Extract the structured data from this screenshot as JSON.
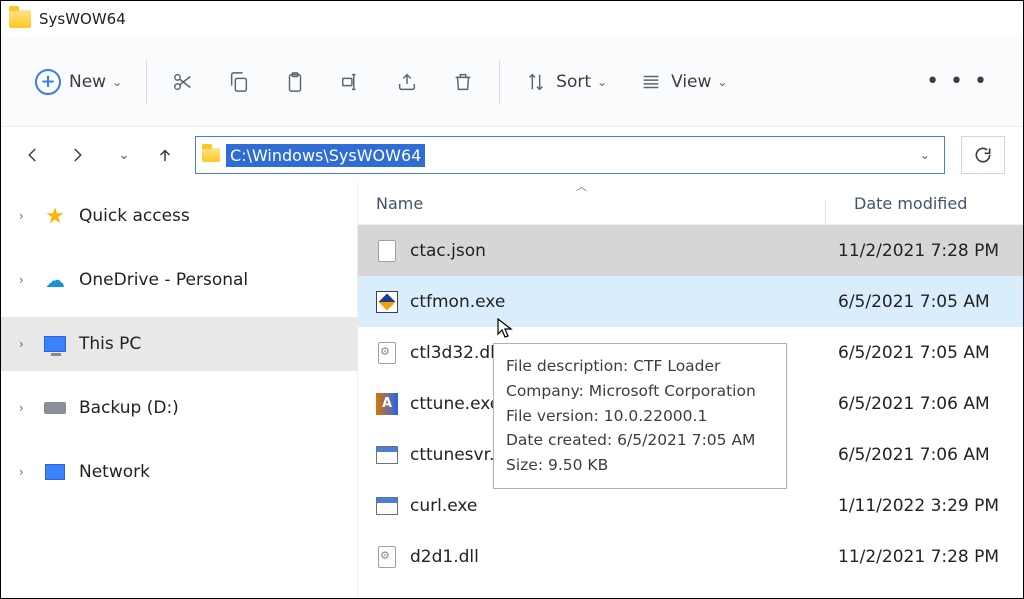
{
  "window": {
    "title": "SysWOW64"
  },
  "toolbar": {
    "new": "New",
    "sort": "Sort",
    "view": "View"
  },
  "address": {
    "path": "C:\\Windows\\SysWOW64"
  },
  "sidebar": {
    "items": [
      {
        "label": "Quick access"
      },
      {
        "label": "OneDrive - Personal"
      },
      {
        "label": "This PC"
      },
      {
        "label": "Backup (D:)"
      },
      {
        "label": "Network"
      }
    ]
  },
  "columns": {
    "name": "Name",
    "date": "Date modified"
  },
  "files": [
    {
      "name": "ctac.json",
      "date": "11/2/2021 7:28 PM"
    },
    {
      "name": "ctfmon.exe",
      "date": "6/5/2021 7:05 AM"
    },
    {
      "name": "ctl3d32.dll",
      "date": "6/5/2021 7:05 AM"
    },
    {
      "name": "cttune.exe",
      "date": "6/5/2021 7:06 AM"
    },
    {
      "name": "cttunesvr.exe",
      "date": "6/5/2021 7:06 AM"
    },
    {
      "name": "curl.exe",
      "date": "1/11/2022 3:29 PM"
    },
    {
      "name": "d2d1.dll",
      "date": "11/2/2021 7:28 PM"
    }
  ],
  "tooltip": {
    "l1": "File description: CTF Loader",
    "l2": "Company: Microsoft Corporation",
    "l3": "File version: 10.0.22000.1",
    "l4": "Date created: 6/5/2021 7:05 AM",
    "l5": "Size: 9.50 KB"
  }
}
